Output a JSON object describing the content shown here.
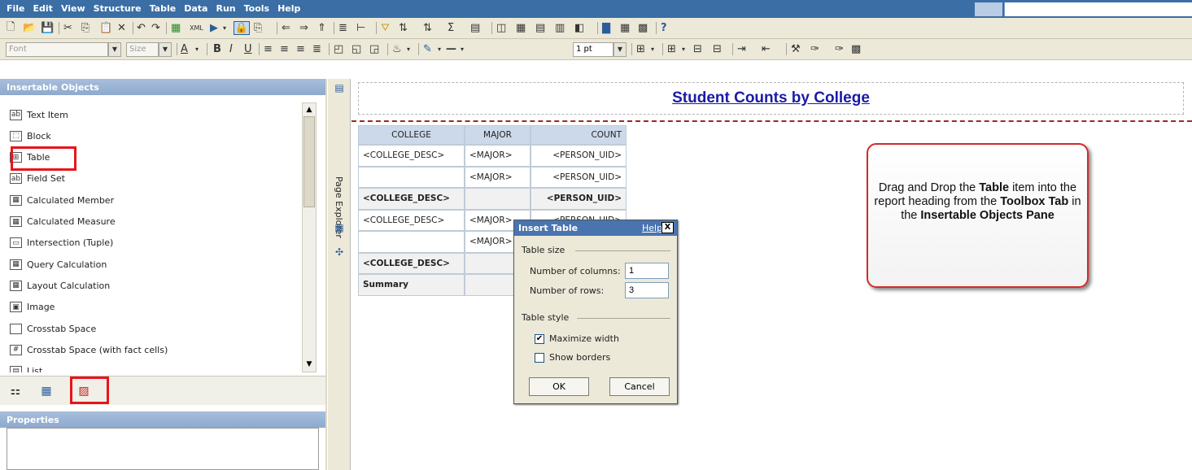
{
  "menu": [
    "File",
    "Edit",
    "View",
    "Structure",
    "Table",
    "Data",
    "Run",
    "Tools",
    "Help"
  ],
  "format_toolbar": {
    "font_placeholder": "Font",
    "size_placeholder": "Size",
    "line_width": "1 pt"
  },
  "insertable_pane": {
    "title": "Insertable Objects",
    "items": [
      {
        "label": "Text Item",
        "icon": "text-item-icon",
        "glyph": "ab"
      },
      {
        "label": "Block",
        "icon": "block-icon",
        "glyph": "⬚"
      },
      {
        "label": "Table",
        "icon": "table-icon",
        "glyph": "⊞"
      },
      {
        "label": "Field Set",
        "icon": "field-set-icon",
        "glyph": "ab"
      },
      {
        "label": "Calculated Member",
        "icon": "calculated-member-icon",
        "glyph": "▦"
      },
      {
        "label": "Calculated Measure",
        "icon": "calculated-measure-icon",
        "glyph": "▦"
      },
      {
        "label": "Intersection (Tuple)",
        "icon": "intersection-icon",
        "glyph": "▭"
      },
      {
        "label": "Query Calculation",
        "icon": "query-calculation-icon",
        "glyph": "▦"
      },
      {
        "label": "Layout Calculation",
        "icon": "layout-calculation-icon",
        "glyph": "▦"
      },
      {
        "label": "Image",
        "icon": "image-icon",
        "glyph": "▣"
      },
      {
        "label": "Crosstab Space",
        "icon": "crosstab-space-icon",
        "glyph": ""
      },
      {
        "label": "Crosstab Space (with fact cells)",
        "icon": "crosstab-space-fact-icon",
        "glyph": "#"
      },
      {
        "label": "List",
        "icon": "list-icon",
        "glyph": "▤"
      }
    ]
  },
  "properties_pane": {
    "title": "Properties"
  },
  "vertical_strip": {
    "label": "Page Explorer"
  },
  "report": {
    "title": "Student Counts by College",
    "headers": [
      "COLLEGE",
      "MAJOR",
      "COUNT"
    ],
    "rows": [
      [
        "<COLLEGE_DESC>",
        "<MAJOR>",
        "<PERSON_UID>"
      ],
      [
        "",
        "<MAJOR>",
        "<PERSON_UID>"
      ],
      [
        "<COLLEGE_DESC>",
        "",
        "<PERSON_UID>"
      ],
      [
        "<COLLEGE_DESC>",
        "<MAJOR>",
        "<PERSON_UID>"
      ],
      [
        "",
        "<MAJOR>",
        ""
      ],
      [
        "<COLLEGE_DESC>",
        "",
        ""
      ],
      [
        "Summary",
        "",
        ""
      ]
    ]
  },
  "dialog": {
    "title": "Insert Table",
    "help": "Help",
    "close": "X",
    "size_section": "Table size",
    "columns_label": "Number of columns:",
    "columns_value": "1",
    "rows_label": "Number of rows:",
    "rows_value": "3",
    "style_section": "Table style",
    "maximize_label": "Maximize width",
    "maximize_checked": true,
    "borders_label": "Show borders",
    "borders_checked": false,
    "ok": "OK",
    "cancel": "Cancel"
  },
  "callout": {
    "p1": "Drag and Drop the ",
    "b1": "Table",
    "p2": " item into the report heading from the ",
    "b2": "Toolbox Tab",
    "p3": " in the ",
    "b3": "Insertable Objects Pane"
  },
  "colors": {
    "menubar": "#3a6ea5",
    "highlight": "#e8141c",
    "title_link": "#1a1aa8"
  }
}
